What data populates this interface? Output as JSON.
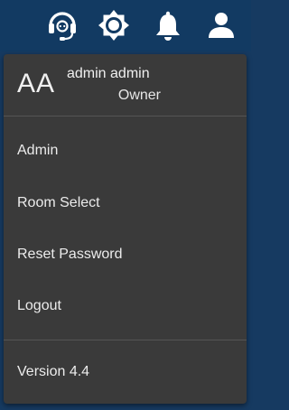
{
  "topbar": {
    "icons": [
      "headset-icon",
      "settings-icon",
      "bell-icon",
      "user-icon"
    ]
  },
  "user_menu": {
    "initials": "AA",
    "name": "admin admin",
    "role": "Owner",
    "items": [
      {
        "label": "Admin"
      },
      {
        "label": "Room Select"
      },
      {
        "label": "Reset Password"
      },
      {
        "label": "Logout"
      }
    ],
    "version": "Version 4.4"
  },
  "colors": {
    "topbar_bg": "#123a62",
    "menu_bg": "#3a3a3a",
    "text": "#ececec"
  }
}
